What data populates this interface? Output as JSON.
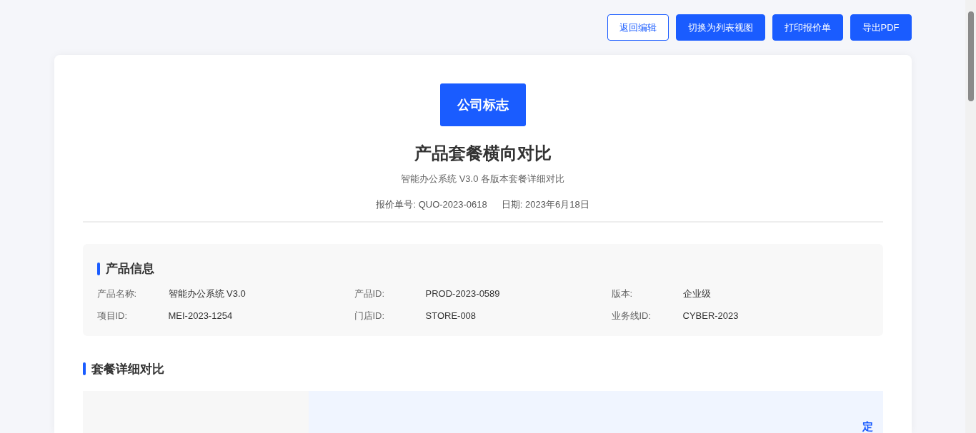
{
  "toolbar": {
    "buttons": [
      {
        "label": "返回编辑",
        "kind": "outline"
      },
      {
        "label": "切换为列表视图",
        "kind": "primary"
      },
      {
        "label": "打印报价单",
        "kind": "primary"
      },
      {
        "label": "导出PDF",
        "kind": "primary"
      }
    ]
  },
  "header": {
    "logo": "公司标志",
    "title": "产品套餐横向对比",
    "subtitle": "智能办公系统 V3.0 各版本套餐详细对比",
    "meta": [
      {
        "label": "报价单号:",
        "value": "QUO-2023-0618"
      },
      {
        "label": "日期:",
        "value": "2023年6月18日"
      }
    ]
  },
  "product_info": {
    "heading": "产品信息",
    "fields": [
      {
        "label": "产品名称:",
        "value": "智能办公系统 V3.0"
      },
      {
        "label": "产品ID:",
        "value": "PROD-2023-0589"
      },
      {
        "label": "版本:",
        "value": "企业级"
      },
      {
        "label": "项目ID:",
        "value": "MEI-2023-1254"
      },
      {
        "label": "门店ID:",
        "value": "STORE-008"
      },
      {
        "label": "业务线ID:",
        "value": "CYBER-2023"
      }
    ]
  },
  "comparison": {
    "heading": "套餐详细对比",
    "table": {
      "columns": [
        "定"
      ]
    }
  }
}
